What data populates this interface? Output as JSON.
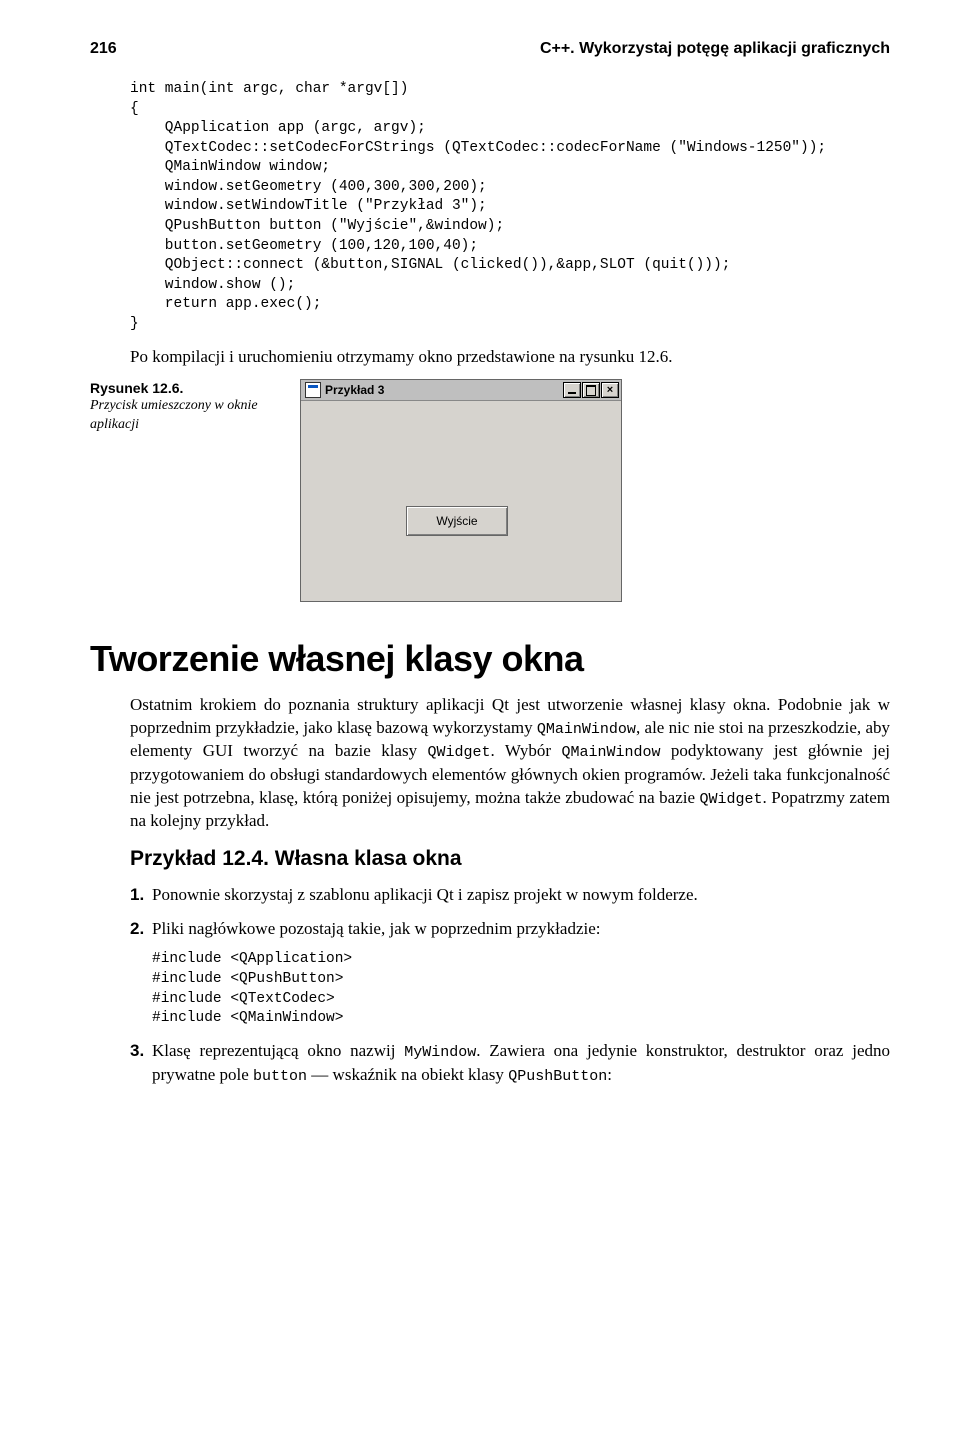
{
  "header": {
    "page_number": "216",
    "running_title": "C++. Wykorzystaj potęgę aplikacji graficznych"
  },
  "code1": "int main(int argc, char *argv[])\n{\n    QApplication app (argc, argv);\n    QTextCodec::setCodecForCStrings (QTextCodec::codecForName (\"Windows-1250\"));\n    QMainWindow window;\n    window.setGeometry (400,300,300,200);\n    window.setWindowTitle (\"Przykład 3\");\n    QPushButton button (\"Wyjście\",&window);\n    button.setGeometry (100,120,100,40);\n    QObject::connect (&button,SIGNAL (clicked()),&app,SLOT (quit()));\n    window.show ();\n    return app.exec();\n}",
  "after_code_text": "Po kompilacji i uruchomieniu otrzymamy okno przedstawione na rysunku 12.6.",
  "figure": {
    "label": "Rysunek 12.6.",
    "desc": "Przycisk umieszczony w oknie aplikacji",
    "window_title": "Przykład 3",
    "button_label": "Wyjście"
  },
  "section_title": "Tworzenie własnej klasy okna",
  "para1_parts": {
    "a": "Ostatnim krokiem do poznania struktury aplikacji Qt jest utworzenie własnej klasy okna. Podobnie jak w poprzednim przykładzie, jako klasę bazową wykorzystamy ",
    "b": "QMainWindow",
    "c": ", ale nic nie stoi na przeszkodzie, aby elementy GUI tworzyć na bazie klasy ",
    "d": "QWidget",
    "e": ". Wybór ",
    "f": "QMainWindow",
    "g": " podyktowany jest głównie jej przygotowaniem do obsługi standardowych elementów głównych okien programów. Jeżeli taka funkcjonalność nie jest potrzebna, klasę, którą poniżej opisujemy, można także zbudować na bazie ",
    "h": "QWidget",
    "i": ". Popatrzmy zatem na kolejny przykład."
  },
  "subsection": "Przykład 12.4. Własna klasa okna",
  "list": {
    "item1": {
      "num": "1.",
      "text": "Ponownie skorzystaj z szablonu aplikacji Qt i zapisz projekt w nowym folderze."
    },
    "item2": {
      "num": "2.",
      "text": "Pliki nagłówkowe pozostają takie, jak w poprzednim przykładzie:"
    },
    "includes": "#include <QApplication>\n#include <QPushButton>\n#include <QTextCodec>\n#include <QMainWindow>",
    "item3": {
      "num": "3.",
      "a": "Klasę reprezentującą okno nazwij ",
      "b": "MyWindow",
      "c": ". Zawiera ona jedynie konstruktor, destruktor oraz jedno prywatne pole ",
      "d": "button",
      "e": " — wskaźnik na obiekt klasy ",
      "f": "QPushButton",
      "g": ":"
    }
  }
}
